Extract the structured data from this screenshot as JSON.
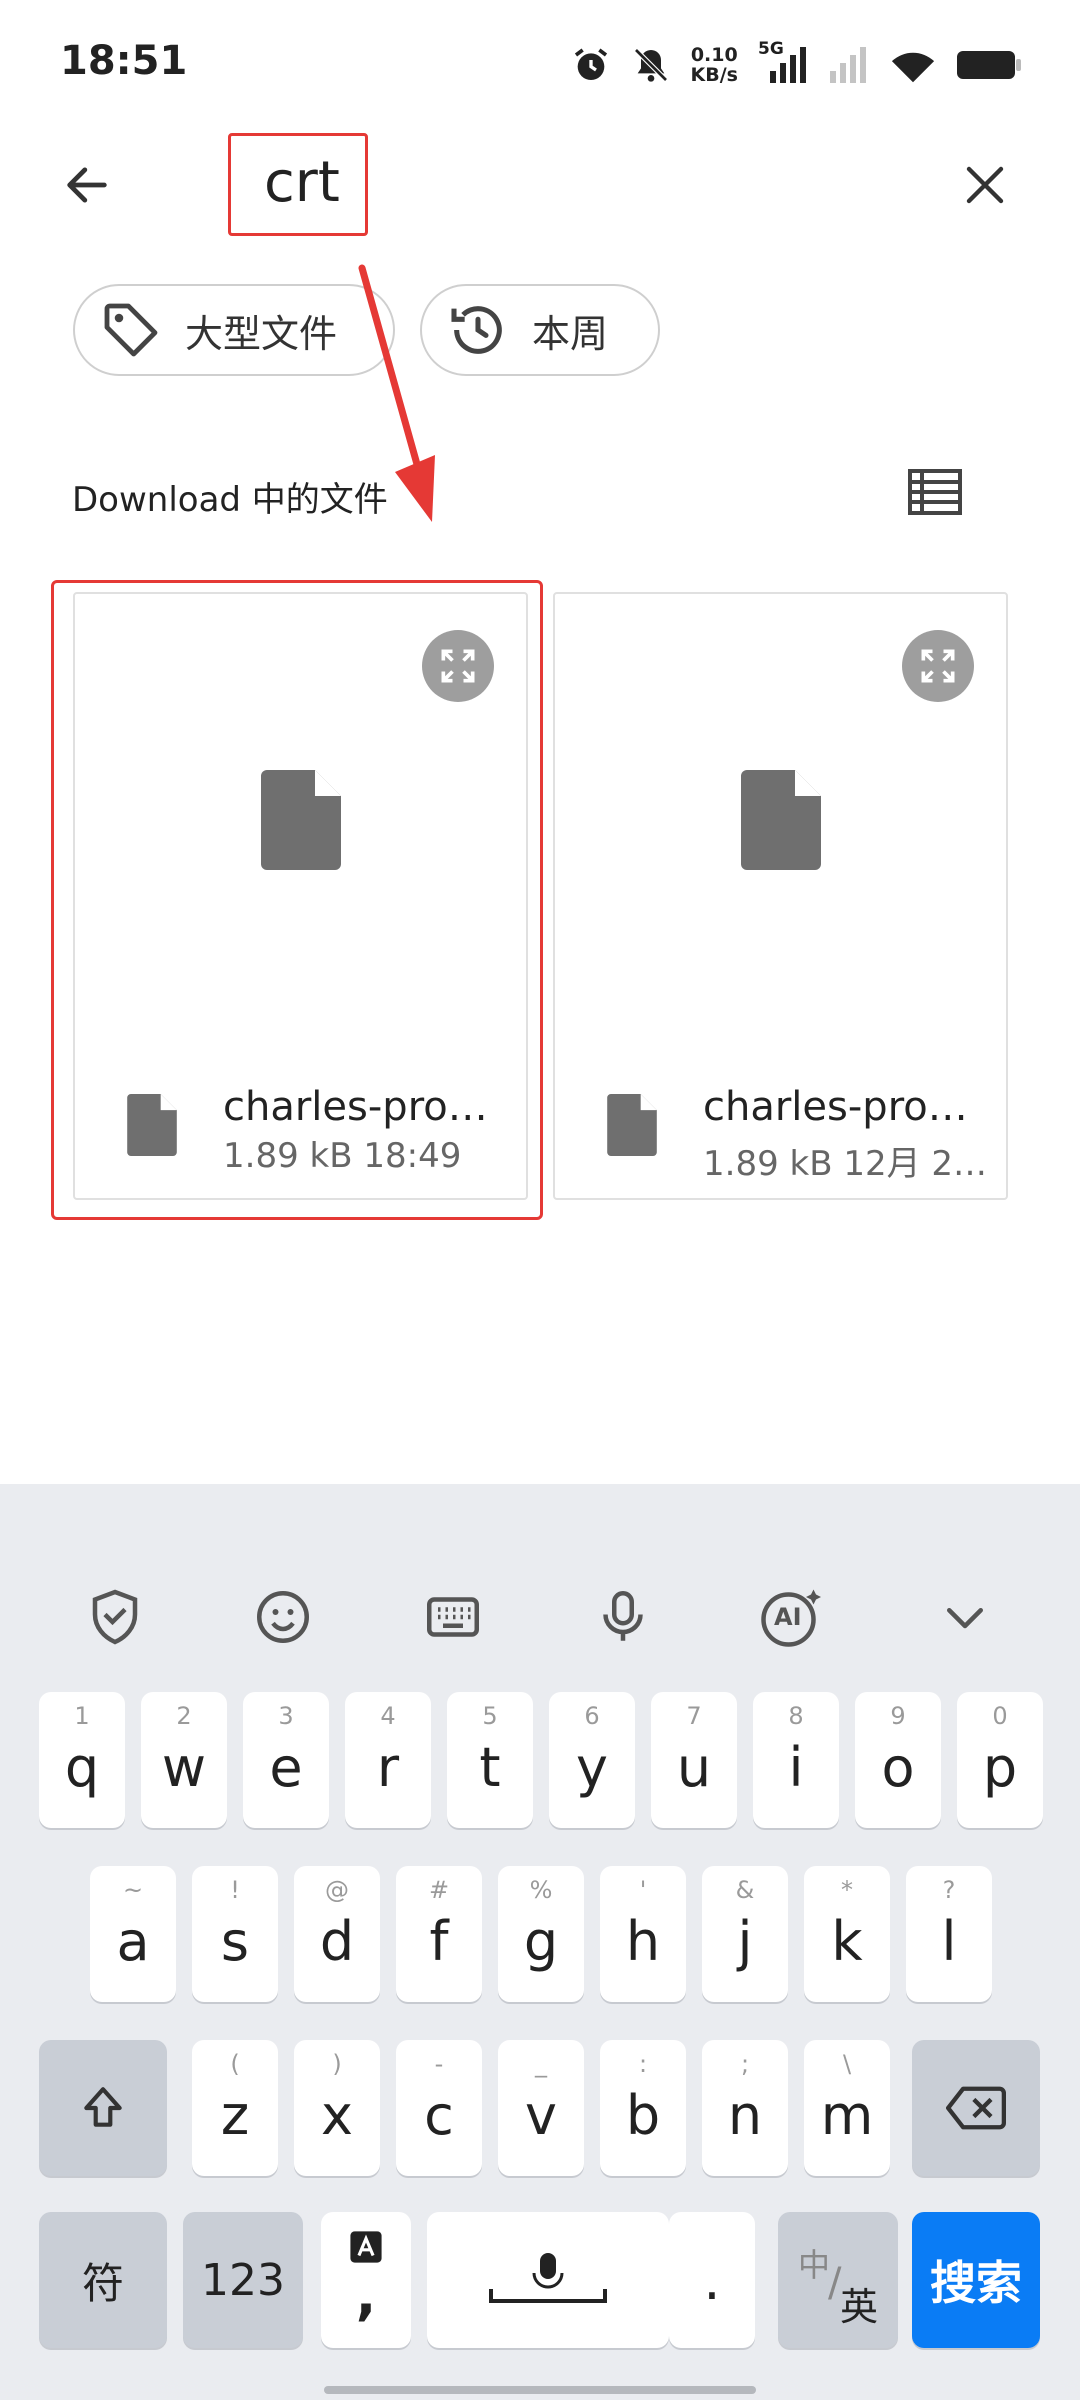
{
  "status_bar": {
    "time": "18:51",
    "net_speed_value": "0.10",
    "net_speed_unit": "KB/s",
    "network_label": "5G"
  },
  "search": {
    "query": "crt"
  },
  "chips": [
    {
      "label": "大型文件",
      "icon": "tag-icon"
    },
    {
      "label": "本周",
      "icon": "history-icon"
    }
  ],
  "section": {
    "title": "Download 中的文件"
  },
  "files": [
    {
      "name": "charles-pro…",
      "size": "1.89 kB",
      "time": "18:49"
    },
    {
      "name": "charles-pro…",
      "size": "1.89 kB",
      "time": "12月 2…"
    }
  ],
  "keyboard": {
    "row1": [
      {
        "key": "q",
        "hint": "1"
      },
      {
        "key": "w",
        "hint": "2"
      },
      {
        "key": "e",
        "hint": "3"
      },
      {
        "key": "r",
        "hint": "4"
      },
      {
        "key": "t",
        "hint": "5"
      },
      {
        "key": "y",
        "hint": "6"
      },
      {
        "key": "u",
        "hint": "7"
      },
      {
        "key": "i",
        "hint": "8"
      },
      {
        "key": "o",
        "hint": "9"
      },
      {
        "key": "p",
        "hint": "0"
      }
    ],
    "row2": [
      {
        "key": "a",
        "hint": "~"
      },
      {
        "key": "s",
        "hint": "!"
      },
      {
        "key": "d",
        "hint": "@"
      },
      {
        "key": "f",
        "hint": "#"
      },
      {
        "key": "g",
        "hint": "%"
      },
      {
        "key": "h",
        "hint": "'"
      },
      {
        "key": "j",
        "hint": "&"
      },
      {
        "key": "k",
        "hint": "*"
      },
      {
        "key": "l",
        "hint": "?"
      }
    ],
    "row3": [
      {
        "key": "z",
        "hint": "("
      },
      {
        "key": "x",
        "hint": ")"
      },
      {
        "key": "c",
        "hint": "-"
      },
      {
        "key": "v",
        "hint": "_"
      },
      {
        "key": "b",
        "hint": ":"
      },
      {
        "key": "n",
        "hint": ";"
      },
      {
        "key": "m",
        "hint": "\\"
      }
    ],
    "symbol_key": "符",
    "number_key": "123",
    "comma_key": ",",
    "period_key": ".",
    "lang_key_cn": "中",
    "lang_key_en": "英",
    "search_key": "搜索",
    "ai_label": "AI"
  },
  "colors": {
    "highlight": "#e53935",
    "search_key": "#0a7cf5",
    "keyboard_bg": "#eaecf0"
  }
}
